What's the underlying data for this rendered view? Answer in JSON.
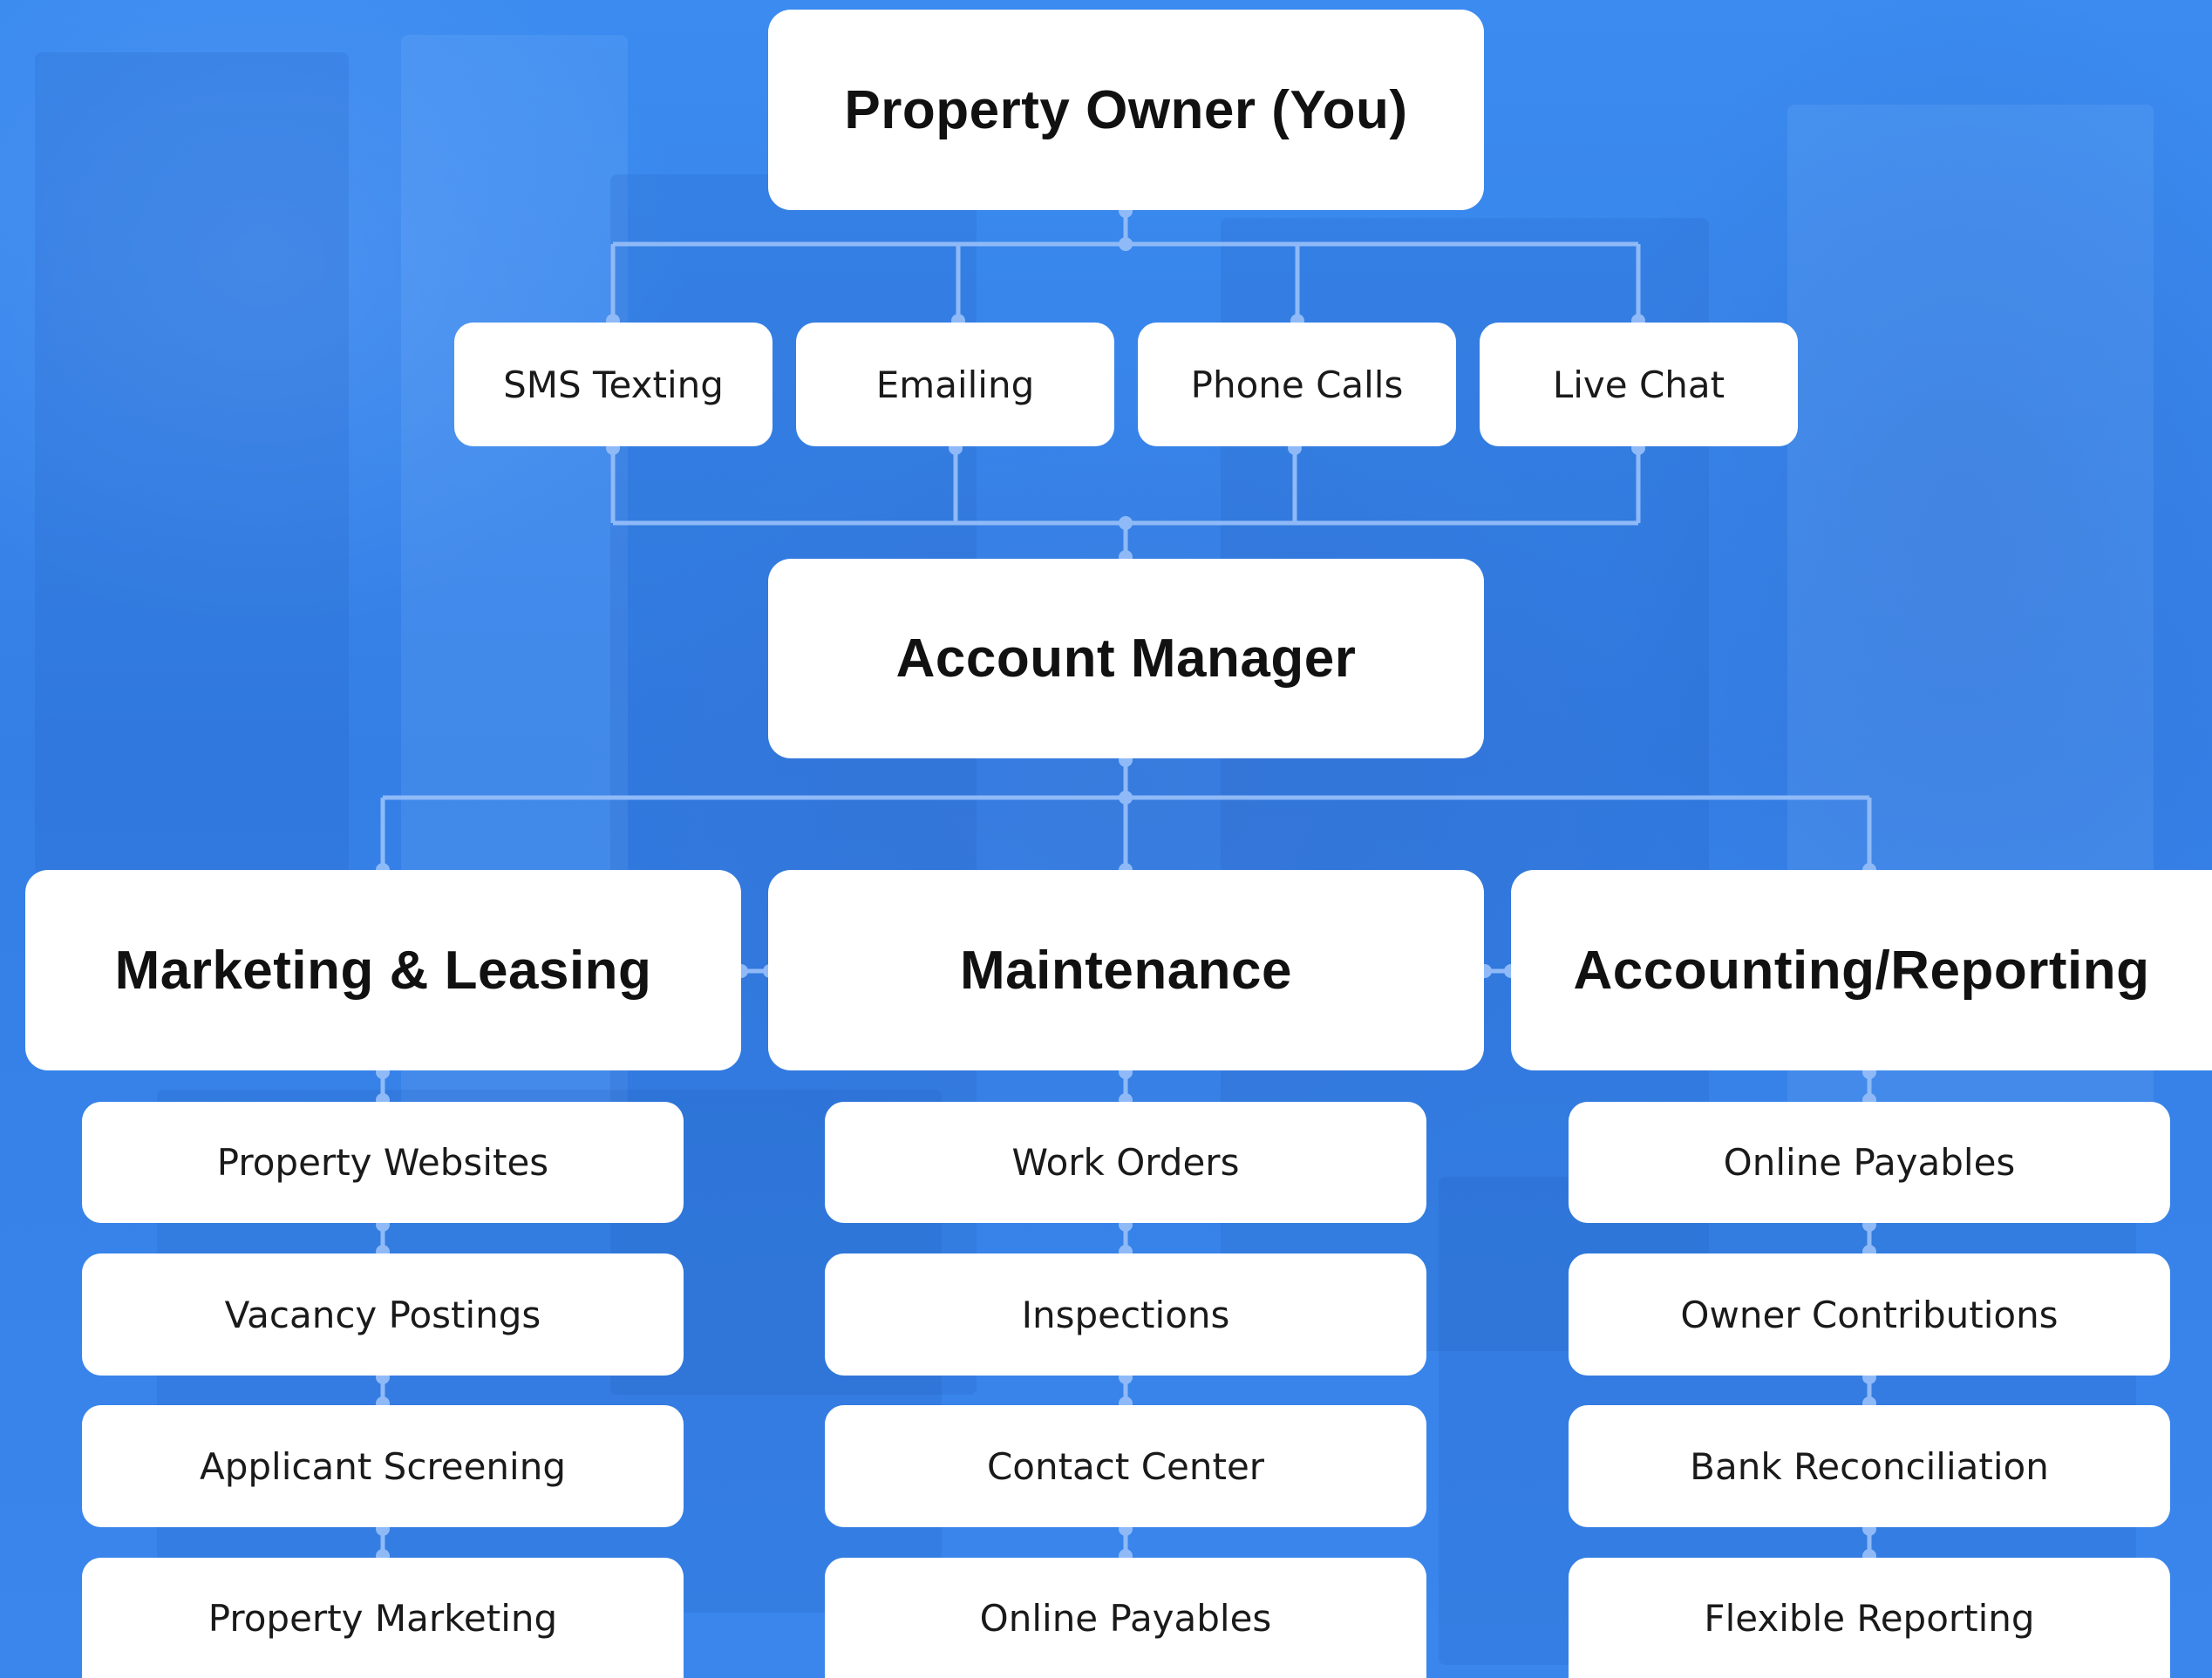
{
  "colors": {
    "background": "#3a86ea",
    "box": "#ffffff",
    "connector": "#8fbaf7",
    "text": "#111111"
  },
  "owner": {
    "label": "Property Owner (You)"
  },
  "channels": [
    {
      "label": "SMS Texting"
    },
    {
      "label": "Emailing"
    },
    {
      "label": "Phone Calls"
    },
    {
      "label": "Live Chat"
    }
  ],
  "manager": {
    "label": "Account Manager"
  },
  "departments": [
    {
      "label": "Marketing & Leasing",
      "services": [
        "Property Websites",
        "Vacancy Postings",
        "Applicant Screening",
        "Property Marketing"
      ]
    },
    {
      "label": "Maintenance",
      "services": [
        "Work Orders",
        "Inspections",
        "Contact Center",
        "Online Payables"
      ]
    },
    {
      "label": "Accounting/Reporting",
      "services": [
        "Online Payables",
        "Owner Contributions",
        "Bank Reconciliation",
        "Flexible Reporting"
      ]
    }
  ]
}
